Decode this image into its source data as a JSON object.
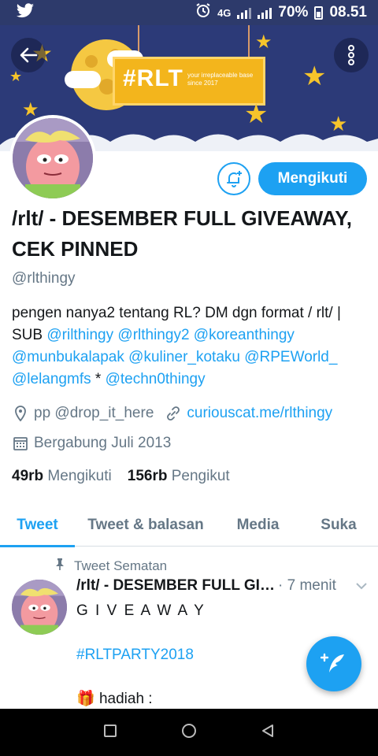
{
  "status_bar": {
    "app_icon": "twitter-bird-icon",
    "alarm_icon": "alarm-clock-icon",
    "network": "4G",
    "battery": "70%",
    "time": "08.51"
  },
  "banner": {
    "tag": "#RLT",
    "subtitle_line1": "your irreplaceable base",
    "subtitle_line2": "since 2017"
  },
  "profile": {
    "name": "/rlt/ - DESEMBER FULL GIVEAWAY, CEK PINNED",
    "handle": "@rlthingy",
    "follow_button": "Mengikuti",
    "bio": {
      "prefix": "pengen nanya2 tentang RL? DM dgn format / rlt/ | SUB ",
      "mention1": "@rilthingy",
      "mention2": "@rlthingy2",
      "mention3": "@koreanthingy",
      "mention4": "@munbukalapak",
      "mention5": "@kuliner_kotaku",
      "mention6": "@RPEWorld_",
      "mention7": "@lelangmfs",
      "separator": " * ",
      "mention8": "@techn0thingy"
    },
    "location": "pp @drop_it_here",
    "website": "curiouscat.me/rlthingy",
    "joined": "Bergabung Juli 2013",
    "following_count": "49rb",
    "following_label": "Mengikuti",
    "followers_count": "156rb",
    "followers_label": "Pengikut"
  },
  "tabs": [
    "Tweet",
    "Tweet & balasan",
    "Media",
    "Suka"
  ],
  "pinned_tweet": {
    "pinned_label": "Tweet Sematan",
    "author": "/rlt/ - DESEMBER FULL GIVEAWAY, CEK PINNED",
    "time": "· 7 menit",
    "line1": "G I V E A W A Y",
    "hashtag": "#RLTPARTY2018",
    "gift_emoji": "🎁",
    "line3": " hadiah :"
  },
  "colors": {
    "accent": "#1da1f2",
    "banner_bg": "#2c3a78",
    "text_secondary": "#657786"
  }
}
